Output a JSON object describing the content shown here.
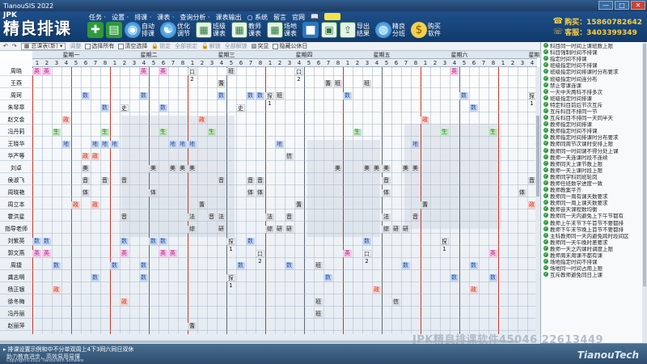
{
  "window": {
    "title": "TianouSIS 2022",
    "buttons": [
      "—",
      "□",
      "✕"
    ]
  },
  "brand": {
    "small": "JPK",
    "name": "精良排课"
  },
  "menus": [
    "任务 ·",
    "设置 ·",
    "排课 ·",
    "课表 ·",
    "查询分析 ·",
    "课表输出",
    "系统",
    "留言",
    "官网"
  ],
  "tools": [
    {
      "name": "add",
      "label": "",
      "icon": "✚",
      "style": "green"
    },
    {
      "name": "import",
      "label": "",
      "icon": "▤",
      "style": "green"
    },
    {
      "name": "auto-schedule",
      "label": "自动排课",
      "icon": "◉",
      "style": "round"
    },
    {
      "name": "optimize",
      "label": "优化调节",
      "icon": "☯",
      "style": "round"
    },
    {
      "name": "class-table",
      "label": "班级课表",
      "icon": "▦",
      "style": "grid"
    },
    {
      "name": "teacher-table",
      "label": "教师课表",
      "icon": "▦",
      "style": "grid"
    },
    {
      "name": "venue-table",
      "label": "场地课表",
      "icon": "▦",
      "style": "grid"
    },
    {
      "name": "save",
      "label": "",
      "icon": "■",
      "style": "disk"
    },
    {
      "name": "print",
      "label": "",
      "icon": "▣",
      "style": "grid"
    },
    {
      "name": "export",
      "label": "导出结果",
      "icon": "⇪",
      "style": "grid"
    },
    {
      "name": "split",
      "label": "精良分班",
      "icon": "◍",
      "style": "round"
    },
    {
      "name": "buy",
      "label": "购买软件",
      "icon": "$",
      "style": "dollar"
    }
  ],
  "contact": {
    "buy": "购买：15860782642",
    "support": "客服：3403399349"
  },
  "subbar": {
    "dropdown": "总课表(新)",
    "items": [
      "调整",
      "选择所有",
      "清空选择",
      "锁定",
      "全部锁定",
      "解锁",
      "全部解锁",
      "突显",
      "隐藏公休日"
    ]
  },
  "days": [
    "星期一",
    "星期二",
    "星期三",
    "星期四",
    "星期五",
    "星期六",
    "星期日"
  ],
  "periods": [
    "1",
    "2",
    "3",
    "4",
    "5",
    "6",
    "7",
    "8"
  ],
  "teachers": [
    "周晓",
    "王燕",
    "周珂",
    "朱琴章",
    "赵文金",
    "冯丹莉",
    "王晓华",
    "华严等",
    "刘卓",
    "侯淑飞",
    "周晓艳",
    "周立本",
    "霍洪星",
    "指导老师",
    "刘紫英",
    "郭文燕",
    "周捷",
    "龚志明",
    "杨正银",
    "徐冬梅",
    "冯丹丽",
    "赵丽萍"
  ],
  "cells": [
    {
      "r": 0,
      "c": 0,
      "t": "英",
      "k": "pink"
    },
    {
      "r": 0,
      "c": 1,
      "t": "英",
      "k": "pink"
    },
    {
      "r": 0,
      "c": 11,
      "t": "英",
      "k": "pink"
    },
    {
      "r": 0,
      "c": 13,
      "t": "英",
      "k": "pink"
    },
    {
      "r": 0,
      "c": 16,
      "t": "口2",
      "k": "white"
    },
    {
      "r": 0,
      "c": 20,
      "t": "班",
      "k": "gray"
    },
    {
      "r": 0,
      "c": 27,
      "t": "口2",
      "k": "white"
    },
    {
      "r": 0,
      "c": 43,
      "t": "英",
      "k": "pink"
    },
    {
      "r": 1,
      "c": 19,
      "t": "蓍",
      "k": "gray"
    },
    {
      "r": 1,
      "c": 30,
      "t": "蓍",
      "k": "gray"
    },
    {
      "r": 1,
      "c": 31,
      "t": "班",
      "k": "gray"
    },
    {
      "r": 1,
      "c": 34,
      "t": "班",
      "k": "gray"
    },
    {
      "r": 2,
      "c": 5,
      "t": "数",
      "k": "blue"
    },
    {
      "r": 2,
      "c": 11,
      "t": "数",
      "k": "blue"
    },
    {
      "r": 2,
      "c": 19,
      "t": "数",
      "k": "blue"
    },
    {
      "r": 2,
      "c": 22,
      "t": "数",
      "k": "blue"
    },
    {
      "r": 2,
      "c": 23,
      "t": "数",
      "k": "blue"
    },
    {
      "r": 2,
      "c": 24,
      "t": "探1",
      "k": "white"
    },
    {
      "r": 2,
      "c": 25,
      "t": "班",
      "k": "gray"
    },
    {
      "r": 2,
      "c": 32,
      "t": "数",
      "k": "blue"
    },
    {
      "r": 2,
      "c": 44,
      "t": "数",
      "k": "blue"
    },
    {
      "r": 2,
      "c": 51,
      "t": "探1",
      "k": "white"
    },
    {
      "r": 3,
      "c": 7,
      "t": "数",
      "k": "blue"
    },
    {
      "r": 3,
      "c": 9,
      "t": "史",
      "k": "white"
    },
    {
      "r": 3,
      "c": 13,
      "t": "数",
      "k": "blue"
    },
    {
      "r": 3,
      "c": 21,
      "t": "史",
      "k": "white"
    },
    {
      "r": 3,
      "c": 45,
      "t": "数",
      "k": "blue"
    },
    {
      "r": 4,
      "c": 3,
      "t": "政",
      "k": "red"
    },
    {
      "r": 4,
      "c": 17,
      "t": "政",
      "k": "red"
    },
    {
      "r": 4,
      "c": 40,
      "t": "政",
      "k": "red"
    },
    {
      "r": 5,
      "c": 2,
      "t": "生",
      "k": "green"
    },
    {
      "r": 5,
      "c": 7,
      "t": "生",
      "k": "green"
    },
    {
      "r": 5,
      "c": 13,
      "t": "生",
      "k": "green"
    },
    {
      "r": 5,
      "c": 18,
      "t": "生",
      "k": "green"
    },
    {
      "r": 5,
      "c": 33,
      "t": "生",
      "k": "green"
    },
    {
      "r": 5,
      "c": 42,
      "t": "生",
      "k": "green"
    },
    {
      "r": 5,
      "c": 47,
      "t": "生",
      "k": "green"
    },
    {
      "r": 6,
      "c": 3,
      "t": "地",
      "k": "blue"
    },
    {
      "r": 6,
      "c": 6,
      "t": "地",
      "k": "blue"
    },
    {
      "r": 6,
      "c": 7,
      "t": "地",
      "k": "blue"
    },
    {
      "r": 6,
      "c": 8,
      "t": "地",
      "k": "blue"
    },
    {
      "r": 6,
      "c": 14,
      "t": "地",
      "k": "blue"
    },
    {
      "r": 6,
      "c": 15,
      "t": "地",
      "k": "blue"
    },
    {
      "r": 6,
      "c": 16,
      "t": "地",
      "k": "blue"
    },
    {
      "r": 6,
      "c": 25,
      "t": "地",
      "k": "blue"
    },
    {
      "r": 6,
      "c": 39,
      "t": "地",
      "k": "blue"
    },
    {
      "r": 7,
      "c": 5,
      "t": "政",
      "k": "red"
    },
    {
      "r": 7,
      "c": 6,
      "t": "政",
      "k": "red"
    },
    {
      "r": 7,
      "c": 26,
      "t": "信",
      "k": "gray"
    },
    {
      "r": 7,
      "c": 53,
      "t": "信",
      "k": "gray"
    },
    {
      "r": 8,
      "c": 5,
      "t": "美",
      "k": "gray"
    },
    {
      "r": 8,
      "c": 12,
      "t": "美",
      "k": "gray"
    },
    {
      "r": 8,
      "c": 14,
      "t": "美",
      "k": "gray"
    },
    {
      "r": 8,
      "c": 15,
      "t": "美",
      "k": "gray"
    },
    {
      "r": 8,
      "c": 16,
      "t": "美",
      "k": "gray"
    },
    {
      "r": 8,
      "c": 31,
      "t": "美",
      "k": "gray"
    },
    {
      "r": 8,
      "c": 34,
      "t": "美",
      "k": "gray"
    },
    {
      "r": 8,
      "c": 35,
      "t": "美",
      "k": "gray"
    },
    {
      "r": 8,
      "c": 36,
      "t": "美",
      "k": "gray"
    },
    {
      "r": 8,
      "c": 38,
      "t": "美",
      "k": "gray"
    },
    {
      "r": 8,
      "c": 39,
      "t": "美",
      "k": "gray"
    },
    {
      "r": 8,
      "c": 52,
      "t": "美",
      "k": "gray"
    },
    {
      "r": 9,
      "c": 5,
      "t": "音",
      "k": "gray"
    },
    {
      "r": 9,
      "c": 7,
      "t": "音",
      "k": "gray"
    },
    {
      "r": 9,
      "c": 9,
      "t": "音",
      "k": "gray"
    },
    {
      "r": 9,
      "c": 19,
      "t": "音",
      "k": "gray"
    },
    {
      "r": 9,
      "c": 22,
      "t": "音",
      "k": "gray"
    },
    {
      "r": 9,
      "c": 23,
      "t": "音",
      "k": "gray"
    },
    {
      "r": 9,
      "c": 36,
      "t": "音",
      "k": "gray"
    },
    {
      "r": 9,
      "c": 51,
      "t": "音",
      "k": "gray"
    },
    {
      "r": 10,
      "c": 5,
      "t": "体",
      "k": "gray"
    },
    {
      "r": 10,
      "c": 12,
      "t": "体",
      "k": "gray"
    },
    {
      "r": 10,
      "c": 22,
      "t": "体",
      "k": "gray"
    },
    {
      "r": 10,
      "c": 23,
      "t": "体",
      "k": "gray"
    },
    {
      "r": 10,
      "c": 36,
      "t": "体",
      "k": "gray"
    },
    {
      "r": 10,
      "c": 50,
      "t": "体",
      "k": "gray"
    },
    {
      "r": 10,
      "c": 52,
      "t": "体",
      "k": "gray"
    },
    {
      "r": 11,
      "c": 4,
      "t": "政",
      "k": "red"
    },
    {
      "r": 11,
      "c": 6,
      "t": "政",
      "k": "red"
    },
    {
      "r": 11,
      "c": 17,
      "t": "蓍",
      "k": "gray"
    },
    {
      "r": 11,
      "c": 27,
      "t": "蓍",
      "k": "gray"
    },
    {
      "r": 11,
      "c": 40,
      "t": "蓍",
      "k": "gray"
    },
    {
      "r": 11,
      "c": 51,
      "t": "政",
      "k": "red"
    },
    {
      "r": 12,
      "c": 9,
      "t": "音",
      "k": "gray"
    },
    {
      "r": 12,
      "c": 16,
      "t": "法",
      "k": "gray"
    },
    {
      "r": 12,
      "c": 18,
      "t": "音",
      "k": "gray"
    },
    {
      "r": 12,
      "c": 19,
      "t": "法",
      "k": "gray"
    },
    {
      "r": 12,
      "c": 24,
      "t": "法",
      "k": "gray"
    },
    {
      "r": 12,
      "c": 26,
      "t": "音",
      "k": "gray"
    },
    {
      "r": 12,
      "c": 36,
      "t": "法",
      "k": "gray"
    },
    {
      "r": 12,
      "c": 39,
      "t": "音",
      "k": "gray"
    },
    {
      "r": 13,
      "c": 16,
      "t": "综",
      "k": "gray"
    },
    {
      "r": 13,
      "c": 19,
      "t": "研",
      "k": "gray"
    },
    {
      "r": 13,
      "c": 24,
      "t": "综",
      "k": "gray"
    },
    {
      "r": 13,
      "c": 25,
      "t": "研",
      "k": "gray"
    },
    {
      "r": 13,
      "c": 26,
      "t": "研",
      "k": "gray"
    },
    {
      "r": 13,
      "c": 36,
      "t": "综",
      "k": "gray"
    },
    {
      "r": 13,
      "c": 37,
      "t": "研",
      "k": "gray"
    },
    {
      "r": 13,
      "c": 38,
      "t": "研",
      "k": "gray"
    },
    {
      "r": 14,
      "c": 0,
      "t": "数",
      "k": "blue"
    },
    {
      "r": 14,
      "c": 1,
      "t": "数",
      "k": "blue"
    },
    {
      "r": 14,
      "c": 9,
      "t": "数",
      "k": "blue"
    },
    {
      "r": 14,
      "c": 12,
      "t": "数",
      "k": "blue"
    },
    {
      "r": 14,
      "c": 13,
      "t": "数",
      "k": "blue"
    },
    {
      "r": 14,
      "c": 20,
      "t": "探1",
      "k": "white"
    },
    {
      "r": 14,
      "c": 22,
      "t": "数",
      "k": "blue"
    },
    {
      "r": 14,
      "c": 34,
      "t": "数",
      "k": "blue"
    },
    {
      "r": 14,
      "c": 42,
      "t": "探1",
      "k": "white"
    },
    {
      "r": 15,
      "c": 0,
      "t": "英",
      "k": "pink"
    },
    {
      "r": 15,
      "c": 1,
      "t": "英",
      "k": "pink"
    },
    {
      "r": 15,
      "c": 9,
      "t": "英",
      "k": "pink"
    },
    {
      "r": 15,
      "c": 13,
      "t": "英",
      "k": "pink"
    },
    {
      "r": 15,
      "c": 14,
      "t": "英",
      "k": "pink"
    },
    {
      "r": 15,
      "c": 23,
      "t": "口2",
      "k": "white"
    },
    {
      "r": 15,
      "c": 32,
      "t": "英",
      "k": "pink"
    },
    {
      "r": 15,
      "c": 34,
      "t": "口2",
      "k": "white"
    },
    {
      "r": 15,
      "c": 47,
      "t": "英",
      "k": "pink"
    },
    {
      "r": 16,
      "c": 2,
      "t": "数",
      "k": "blue"
    },
    {
      "r": 16,
      "c": 8,
      "t": "数",
      "k": "blue"
    },
    {
      "r": 16,
      "c": 11,
      "t": "数",
      "k": "blue"
    },
    {
      "r": 16,
      "c": 21,
      "t": "数",
      "k": "blue"
    },
    {
      "r": 16,
      "c": 26,
      "t": "数",
      "k": "blue"
    },
    {
      "r": 16,
      "c": 29,
      "t": "班",
      "k": "gray"
    },
    {
      "r": 16,
      "c": 38,
      "t": "数",
      "k": "blue"
    },
    {
      "r": 16,
      "c": 45,
      "t": "数",
      "k": "blue"
    },
    {
      "r": 17,
      "c": 6,
      "t": "数",
      "k": "blue"
    },
    {
      "r": 17,
      "c": 11,
      "t": "数",
      "k": "blue"
    },
    {
      "r": 17,
      "c": 20,
      "t": "探1",
      "k": "white"
    },
    {
      "r": 17,
      "c": 30,
      "t": "数",
      "k": "blue"
    },
    {
      "r": 17,
      "c": 43,
      "t": "数",
      "k": "blue"
    },
    {
      "r": 17,
      "c": 47,
      "t": "数",
      "k": "blue"
    },
    {
      "r": 18,
      "c": 2,
      "t": "政",
      "k": "red"
    },
    {
      "r": 18,
      "c": 35,
      "t": "政",
      "k": "red"
    },
    {
      "r": 18,
      "c": 45,
      "t": "政",
      "k": "red"
    },
    {
      "r": 19,
      "c": 9,
      "t": "政",
      "k": "red"
    },
    {
      "r": 19,
      "c": 29,
      "t": "班",
      "k": "gray"
    },
    {
      "r": 19,
      "c": 37,
      "t": "信",
      "k": "gray"
    },
    {
      "r": 20,
      "c": 29,
      "t": "班",
      "k": "gray"
    },
    {
      "r": 21,
      "c": 16,
      "t": "蓍",
      "k": "gray"
    }
  ],
  "rules": [
    "科目同一时间上课班数上限",
    "科目强制时间不排课",
    "指定时间不排课",
    "班级指定时间不排课",
    "班级指定时间排课时分布要求",
    "班级指定时间连分布",
    "禁止零课连课",
    "一天中天两科不排多次",
    "班级指定时间排课",
    "特定科目前后节次互斥",
    "互斥科目不排同一节",
    "互斥科目不排同一天同半天",
    "教师指定时间排课",
    "教师指定时间不排课",
    "教师指定时间排课时分布要求",
    "教师同周节次课时安排上限",
    "教师同一时间课不得分处上课",
    "教师一天连课时段不连续",
    "教师同天上课节数上限",
    "教师一天上课时段上限",
    "教师同学科同班轮岗",
    "教师任班数学进度一致",
    "教师教案平齐",
    "教师同一周有课天数要求",
    "教师同一周上课天数要求",
    "教师音天课程数均衡",
    "教师同一天内避免上下午节都有",
    "教师上午末节下午首节不要都排",
    "教师下午末节晚上首节不要都排",
    "主科教师同一天内避免跨时段间区",
    "教师同一天午晚时差要求",
    "教师一天之内课时调度上限",
    "教师周末周课不都有课",
    "场地指定时间不排课",
    "场地同一时间占用上限",
    "互斥教师避免同日上课"
  ],
  "status": {
    "marquee_tag": "",
    "marquee": "排课设置示例和中不分单双周上4下3同六同日双休",
    "sub1": "助力教育进步，高效易用易懂",
    "sub2": "Copyright©2022 TianouTech Software",
    "brand": "TianouTech"
  },
  "watermark": "JPK精良排课软件45046 22613449"
}
